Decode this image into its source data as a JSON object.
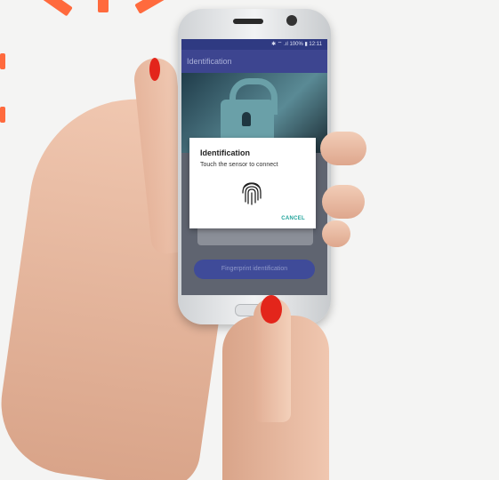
{
  "phone": {
    "status_bar": "✱ ⌔ .ıl 100% ▮ 12:11",
    "app_title": "Identification",
    "primary_button_label": "Fingerprint identification"
  },
  "dialog": {
    "title": "Identification",
    "message": "Touch the sensor to connect",
    "cancel_label": "CANCEL",
    "icon": "fingerprint-icon"
  },
  "colors": {
    "app_bar": "#3d4590",
    "accent": "#1fa39a",
    "nail_polish": "#e3251b",
    "decor": "#ff6a3d"
  }
}
